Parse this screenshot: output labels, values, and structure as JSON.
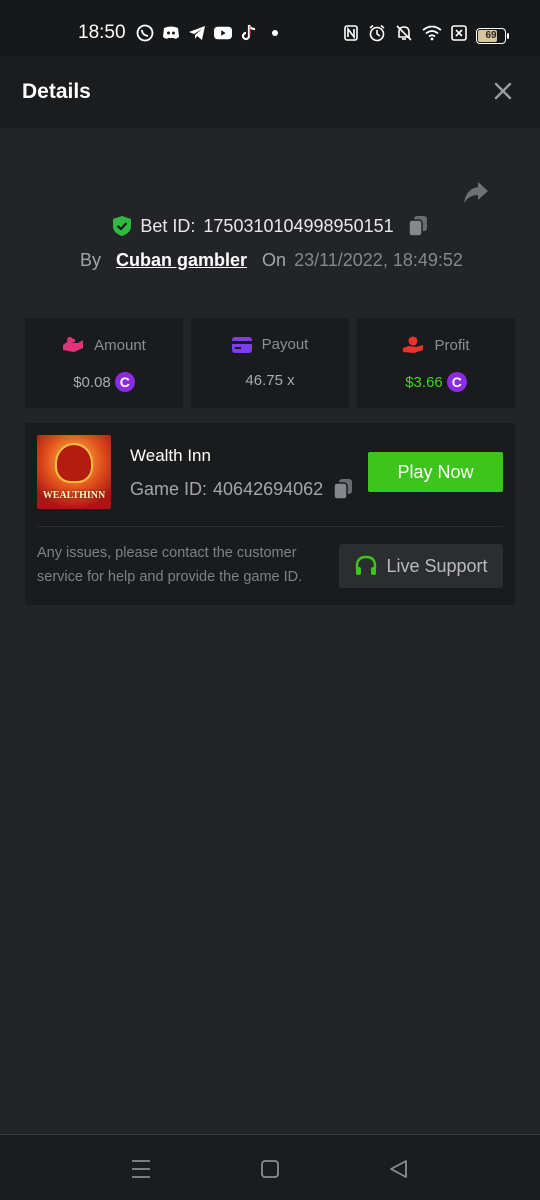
{
  "status_bar": {
    "time": "18:50",
    "battery_level": "69",
    "app_icons": [
      "whatsapp-icon",
      "discord-icon",
      "telegram-icon",
      "youtube-icon",
      "tiktok-icon",
      "dot-icon"
    ],
    "system_icons": [
      "nfc-icon",
      "alarm-icon",
      "mute-icon",
      "wifi-icon",
      "sim-off-icon",
      "battery-icon"
    ]
  },
  "header": {
    "title": "Details"
  },
  "bet": {
    "bet_id_label": "Bet ID:",
    "bet_id": "1750310104998950151",
    "by_label": "By",
    "username": "Cuban gambler",
    "on_label": "On",
    "date": "23/11/2022, 18:49:52"
  },
  "stats": {
    "amount": {
      "label": "Amount",
      "value": "$0.08"
    },
    "payout": {
      "label": "Payout",
      "value": "46.75 x"
    },
    "profit": {
      "label": "Profit",
      "value": "$3.66"
    },
    "currency_symbol": "C"
  },
  "game": {
    "name": "Wealth Inn",
    "id_label": "Game ID:",
    "id": "40642694062",
    "thumbnail_text": "WEALTHINN",
    "play_label": "Play Now",
    "issue_text": "Any issues, please contact the customer service for help and provide the game ID.",
    "support_label": "Live Support"
  },
  "colors": {
    "accent_green": "#3cc51a",
    "profit_green": "#47d226",
    "coin_purple": "#8b2be2",
    "amount_icon": "#e0337a",
    "payout_icon": "#7e3cf0",
    "profit_icon": "#e8342a"
  }
}
